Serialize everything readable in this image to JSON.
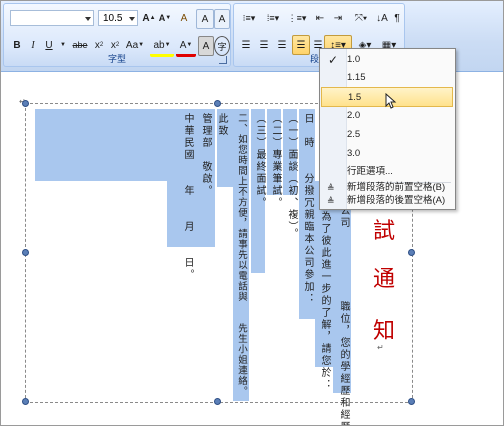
{
  "ribbon": {
    "font_name_value": "",
    "font_size_value": "10.5",
    "font_group_label": "字型",
    "para_group_label": "段落",
    "buttons": {
      "grow_font": "A",
      "shrink_font": "A",
      "clear_format": "A",
      "phonetic": "A",
      "bold": "B",
      "italic": "I",
      "underline": "U",
      "strikethrough": "abe",
      "subscript": "x",
      "superscript": "x",
      "change_case": "Aa",
      "highlight": "ab",
      "font_color": "A",
      "char_border": "A",
      "char_shade": "字"
    }
  },
  "line_spacing_menu": {
    "items": [
      "1.0",
      "1.15",
      "1.5",
      "2.0",
      "2.5",
      "3.0"
    ],
    "checked": "1.0",
    "hovered": "1.5",
    "options_label": "行距選項...",
    "add_space_before": "新增段落的前置空格(B)",
    "add_space_after": "新增段落的後置空格(A)"
  },
  "document": {
    "title_chars": [
      "試",
      "通",
      "知"
    ],
    "columns": [
      "公司　　　　　　職位，您的學經歷和經歷",
      "象，為了彼此進一步的了解，請您於：",
      "日　時　　分撥冗親臨本公司參加：",
      "（一）面談（初、複）。",
      "（二）專業筆試。",
      "（三）最終面試。",
      "二、如您時間上不方便，請事先以電話與　　先生小姐連絡。",
      "此致",
      "管理部　敬啟。",
      "中華民國　　年　　月　　日。"
    ]
  },
  "colors": {
    "accent_ribbon": "#c9dbf5",
    "highlight": "#a9c7ee",
    "title_red": "#c00000",
    "menu_hover": "#ffe28c"
  }
}
